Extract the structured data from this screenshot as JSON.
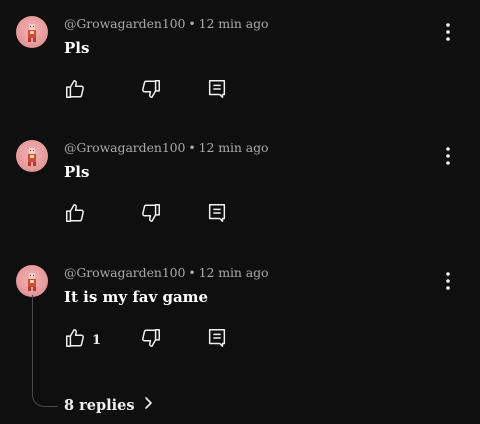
{
  "comments": [
    {
      "author": "@Growagarden100",
      "separator": "•",
      "time": "12 min ago",
      "text": "Pls",
      "like_count": ""
    },
    {
      "author": "@Growagarden100",
      "separator": "•",
      "time": "12 min ago",
      "text": "Pls",
      "like_count": ""
    },
    {
      "author": "@Growagarden100",
      "separator": "•",
      "time": "12 min ago",
      "text": "It is my fav game",
      "like_count": "1"
    }
  ],
  "replies": {
    "label": "8 replies"
  },
  "icons": {
    "like": "thumbs-up-icon",
    "dislike": "thumbs-down-icon",
    "reply": "comment-reply-icon",
    "menu": "more-vertical-icon",
    "expand": "chevron-right-icon"
  },
  "colors": {
    "background": "#0f0f0f",
    "meta_text": "#aaaaaa",
    "text": "#ffffff",
    "avatar": "#e69a9c"
  }
}
